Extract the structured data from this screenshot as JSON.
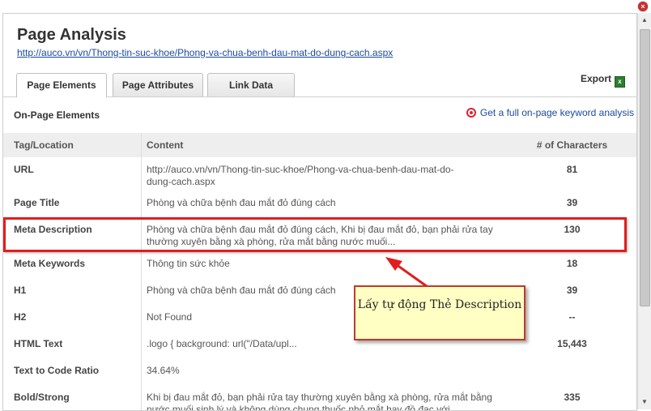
{
  "window": {
    "close_label": "×"
  },
  "dialog": {
    "title": "Page Analysis",
    "url": "http://auco.vn/vn/Thong-tin-suc-khoe/Phong-va-chua-benh-dau-mat-do-dung-cach.aspx",
    "tabs": [
      {
        "label": "Page Elements",
        "active": true
      },
      {
        "label": "Page Attributes",
        "active": false
      },
      {
        "label": "Link Data",
        "active": false
      }
    ],
    "export_label": "Export",
    "export_icon": "excel-icon",
    "section_title": "On-Page Elements",
    "keyword_link": "Get a full on-page keyword analysis"
  },
  "table": {
    "headers": {
      "tag": "Tag/Location",
      "content": "Content",
      "count": "# of Characters"
    },
    "rows": [
      {
        "tag": "URL",
        "content": "http://auco.vn/vn/Thong-tin-suc-khoe/Phong-va-chua-benh-dau-mat-do-dung-cach.aspx",
        "count": "81"
      },
      {
        "tag": "Page Title",
        "content": "Phòng và chữa bệnh đau mắt đỏ đúng cách",
        "count": "39"
      },
      {
        "tag": "Meta Description",
        "content": "Phòng và chữa bệnh đau mắt đỏ đúng cách, Khi bị đau mắt đỏ, bạn phải rửa tay thường xuyên bằng xà phòng, rửa mắt bằng nước muối...",
        "count": "130"
      },
      {
        "tag": "Meta Keywords",
        "content": "Thông tin sức khỏe",
        "count": "18"
      },
      {
        "tag": "H1",
        "content": "Phòng và chữa bệnh đau mắt đỏ đúng cách",
        "count": "39"
      },
      {
        "tag": "H2",
        "content": "Not Found",
        "count": "--"
      },
      {
        "tag": "HTML Text",
        "content": ".logo { background: url(\"/Data/upl...",
        "count": "15,443"
      },
      {
        "tag": "Text to Code Ratio",
        "content": "34.64%",
        "count": ""
      },
      {
        "tag": "Bold/Strong",
        "content": "Khi bị đau mắt đỏ, bạn phải rửa tay thường xuyên bằng xà phòng, rửa mắt bằng nước muối sinh lý và không dùng chung thuốc nhỏ mắt hay đồ đạc với",
        "count": "335"
      }
    ]
  },
  "annotation": {
    "text": "Lấy tự động Thẻ Description",
    "color": "#e21d1d",
    "background": "#ffffc4"
  }
}
